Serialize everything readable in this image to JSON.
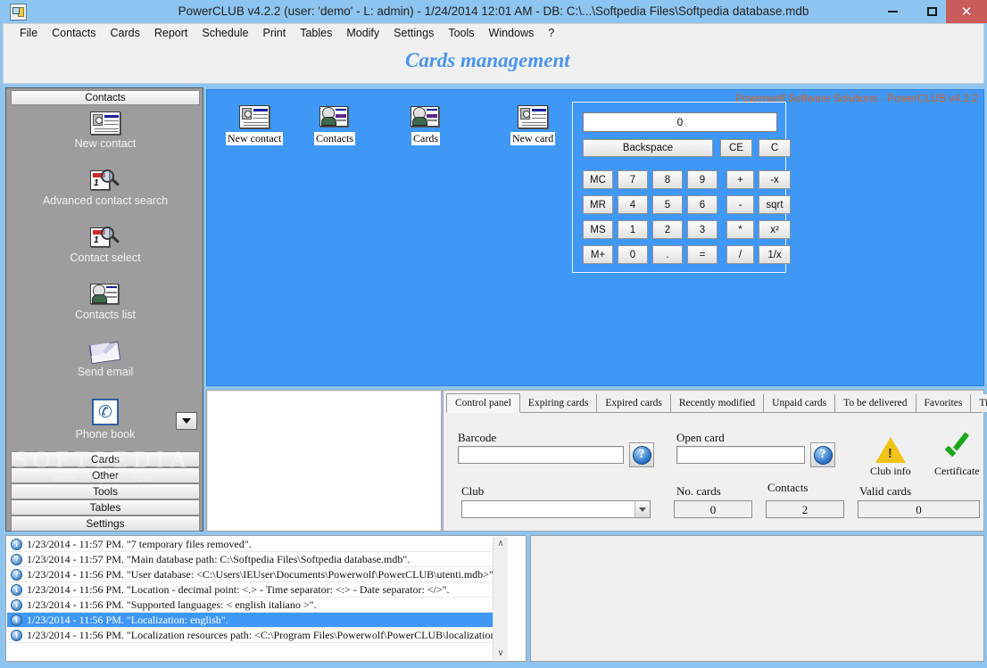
{
  "window": {
    "title": "PowerCLUB v4.2.2  (user: 'demo'  - L: admin) - 1/24/2014 12:01 AM - DB: C:\\...\\Softpedia Files\\Softpedia database.mdb",
    "minimize_label": "–",
    "maximize_label": "❐",
    "close_label": "✕",
    "titlebar_color": "#8ec5f0",
    "close_color": "#c95b5b"
  },
  "menubar": {
    "items": [
      "File",
      "Contacts",
      "Cards",
      "Report",
      "Schedule",
      "Print",
      "Tables",
      "Modify",
      "Settings",
      "Tools",
      "Windows",
      "?"
    ]
  },
  "header": {
    "page_title": "Cards management",
    "page_title_color": "#4a94ea"
  },
  "sidebar": {
    "group_header": "Contacts",
    "entries": [
      {
        "label": "New contact",
        "icon": "contact-card-icon"
      },
      {
        "label": "Advanced contact search",
        "icon": "magnifier-search-icon"
      },
      {
        "label": "Contact select",
        "icon": "magnifier-select-icon"
      },
      {
        "label": "Contacts list",
        "icon": "contacts-list-icon"
      },
      {
        "label": "Send email",
        "icon": "envelope-icon"
      },
      {
        "label": "Phone book",
        "icon": "phone-icon"
      }
    ],
    "dropdown_icon": "chevron-down-icon",
    "buttons": [
      "Cards",
      "Other",
      "Tools",
      "Tables",
      "Settings"
    ],
    "watermark": "SOFTPEDIA",
    "watermark_sub": "www.softpedia.com"
  },
  "main": {
    "background_color": "#3f97f6",
    "watermark": "Powerwolf Software Solutions - PowerCLUB v4.2.2",
    "watermark_color": "#d4601f",
    "desktop_icons": [
      {
        "label": "New contact",
        "icon": "contact-card-icon"
      },
      {
        "label": "Contacts",
        "icon": "contacts-people-icon"
      },
      {
        "label": "Cards",
        "icon": "cards-people-icon"
      },
      {
        "label": "New card",
        "icon": "new-card-icon"
      }
    ]
  },
  "calculator": {
    "display": "0",
    "backspace": "Backspace",
    "ce": "CE",
    "c": "C",
    "keys": [
      [
        "MC",
        "7",
        "8",
        "9",
        "+",
        "-x"
      ],
      [
        "MR",
        "4",
        "5",
        "6",
        "-",
        "sqrt"
      ],
      [
        "MS",
        "1",
        "2",
        "3",
        "*",
        "x²"
      ],
      [
        "M+",
        "0",
        ".",
        "=",
        "/",
        "1/x"
      ]
    ]
  },
  "tabs": {
    "items": [
      "Control panel",
      "Expiring cards",
      "Expired cards",
      "Recently modified",
      "Unpaid cards",
      "To be delivered",
      "Favorites",
      "Tip"
    ],
    "active": "Control panel"
  },
  "control_panel": {
    "barcode_label": "Barcode",
    "barcode_value": "",
    "barcode_help": "?",
    "open_card_label": "Open card",
    "open_card_value": "",
    "open_card_help": "?",
    "club_info_label": "Club info",
    "club_info_icon": "warning-triangle-icon",
    "certificate_label": "Certificate",
    "certificate_icon": "green-check-icon",
    "club_label": "Club",
    "club_value": "",
    "club_dropdown_icon": "chevron-down-icon",
    "no_cards_label": "No. cards",
    "no_cards_value": "0",
    "contacts_label": "Contacts",
    "contacts_value": "2",
    "valid_cards_label": "Valid cards",
    "valid_cards_value": "0"
  },
  "log": {
    "rows": [
      {
        "icon": "info",
        "text": "1/23/2014 - 11:57 PM. \"7 temporary files removed\"."
      },
      {
        "icon": "question",
        "text": "1/23/2014 - 11:57 PM. \"Main database path: C:\\Softpedia Files\\Softpedia database.mdb\"."
      },
      {
        "icon": "question",
        "text": "1/23/2014 - 11:56 PM. \"User database: <C:\\Users\\IEUser\\Documents\\Powerwolf\\PowerCLUB\\utenti.mdb>\"."
      },
      {
        "icon": "info",
        "text": "1/23/2014 - 11:56 PM. \"Location - decimal point: <.> - Time separator: <:> - Date separator: </>\"."
      },
      {
        "icon": "info",
        "text": "1/23/2014 - 11:56 PM. \"Supported languages: < english italiano >\"."
      },
      {
        "icon": "info",
        "text": "1/23/2014 - 11:56 PM. \"Localization: english\".",
        "selected": true
      },
      {
        "icon": "info",
        "text": "1/23/2014 - 11:56 PM. \"Localization resources path: <C:\\Program Files\\Powerwolf\\PowerCLUB\\localization>\"."
      }
    ],
    "scroll_up": "∧",
    "scroll_down": "∨",
    "selected_color": "#3f97f6"
  }
}
